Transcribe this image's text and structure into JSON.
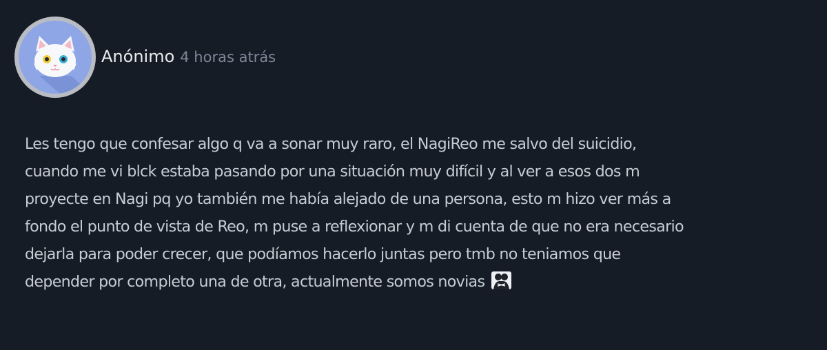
{
  "post": {
    "author": "Anónimo",
    "time": "4 horas atrás",
    "body_lines": [
      "Les tengo que confesar algo q va a sonar muy raro, el NagiReo me salvo del suicidio,",
      "cuando me vi blck estaba pasando por una situación muy difícil y al ver a esos dos m",
      "proyecte en Nagi pq yo también me había alejado de una persona, esto m hizo ver más a",
      "fondo el punto de vista de Reo, m puse a reflexionar y m di cuenta de que no era necesario",
      "dejarla para poder crecer, que podíamos hacerlo juntas pero tmb no teniamos que",
      "depender por completo una de otra, actualmente somos novias"
    ],
    "trailing_icon": "people-hugging-icon",
    "avatar_icon": "white-cat-avatar-icon"
  },
  "colors": {
    "background": "#161c26",
    "author": "#e9ecef",
    "time": "#7d8797",
    "body": "#c6ccd4",
    "avatar_ring": "#b9bcc2",
    "avatar_bg": "#8fa6e6"
  }
}
